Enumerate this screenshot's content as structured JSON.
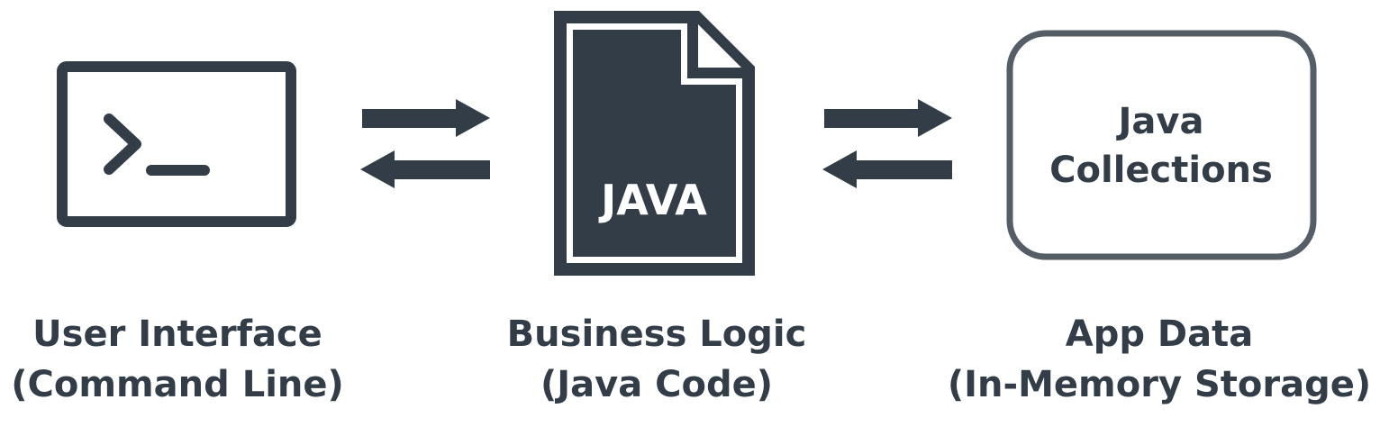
{
  "colors": {
    "icon": "#333d48",
    "box_outline": "#555d66",
    "text": "#333d48",
    "background": "#ffffff"
  },
  "components": [
    {
      "id": "user-interface",
      "icon": "terminal-icon",
      "title": "User Interface",
      "subtitle": "(Command Line)"
    },
    {
      "id": "business-logic",
      "icon": "java-file-icon",
      "icon_text": "JAVA",
      "title": "Business Logic",
      "subtitle": "(Java Code)"
    },
    {
      "id": "app-data",
      "icon": "storage-box-icon",
      "box_line1": "Java",
      "box_line2": "Collections",
      "title": "App Data",
      "subtitle": "(In-Memory Storage)"
    }
  ],
  "connectors": [
    {
      "between": [
        "user-interface",
        "business-logic"
      ],
      "icons": [
        "arrow-right-icon",
        "arrow-left-icon"
      ]
    },
    {
      "between": [
        "business-logic",
        "app-data"
      ],
      "icons": [
        "arrow-right-icon",
        "arrow-left-icon"
      ]
    }
  ]
}
